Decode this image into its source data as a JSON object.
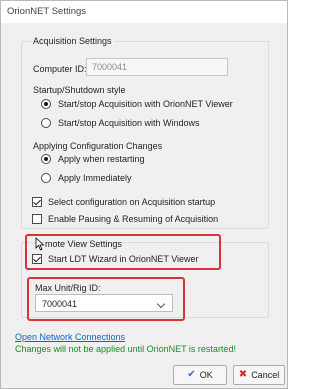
{
  "window": {
    "title": "OrionNET Settings"
  },
  "acquisition": {
    "group_label": "Acquisition Settings",
    "computer_id_label": "Computer ID:",
    "computer_id_value": "7000041",
    "startup_label": "Startup/Shutdown style",
    "startup_options": [
      {
        "label": "Start/stop Acquisition with OrionNET Viewer",
        "selected": true
      },
      {
        "label": "Start/stop Acquisition with Windows",
        "selected": false
      }
    ],
    "config_label": "Applying Configuration Changes",
    "config_options": [
      {
        "label": "Apply when restarting",
        "selected": true
      },
      {
        "label": "Apply Immediately",
        "selected": false
      }
    ],
    "checkboxes": [
      {
        "label": "Select configuration on Acquisition startup",
        "checked": true
      },
      {
        "label": "Enable Pausing & Resuming of Acquisition",
        "checked": false
      }
    ]
  },
  "remote": {
    "group_label": "mote View Settings",
    "ldt_label": "Start LDT Wizard in OrionNET Viewer",
    "ldt_checked": true,
    "max_unit_label": "Max Unit/Rig ID:",
    "max_unit_value": "7000041"
  },
  "footer": {
    "link_label": "Open Network Connections",
    "note": "Changes will not be applied until OrionNET is restarted!",
    "ok_label": "OK",
    "cancel_label": "Cancel"
  },
  "colors": {
    "highlight": "#d9323a",
    "link": "#0b66c2",
    "note": "#1a8a2a",
    "ok_icon": "#2a6fd6",
    "cancel_icon": "#cc2b2b"
  }
}
